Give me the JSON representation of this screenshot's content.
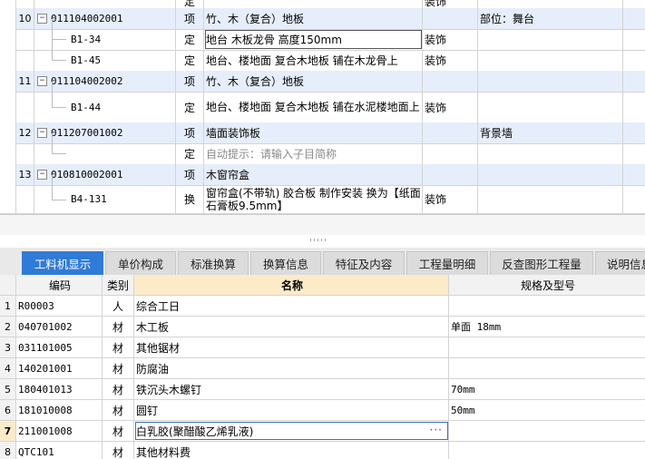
{
  "top_grid": {
    "rows": [
      {
        "idx": "",
        "code": "",
        "type": "定",
        "name": "",
        "major": "装饰",
        "part": "",
        "kind": "child-partial"
      },
      {
        "idx": "10",
        "code": "011104002001",
        "type": "项",
        "name": "竹、木（复合）地板",
        "major": "",
        "part": "部位：舞台",
        "kind": "group"
      },
      {
        "idx": "",
        "code": "B1-34",
        "type": "定",
        "name": "地台 木板龙骨 高度150mm",
        "major": "装饰",
        "part": "",
        "kind": "child"
      },
      {
        "idx": "",
        "code": "B1-45",
        "type": "定",
        "name": "地台、楼地面 复合木地板 铺在木龙骨上",
        "major": "装饰",
        "part": "",
        "kind": "child"
      },
      {
        "idx": "11",
        "code": "011104002002",
        "type": "项",
        "name": "竹、木（复合）地板",
        "major": "",
        "part": "",
        "kind": "group"
      },
      {
        "idx": "",
        "code": "B1-44",
        "type": "定",
        "name": "地台、楼地面 复合木地板 铺在水泥楼地面上",
        "major": "装饰",
        "part": "",
        "kind": "child-tall"
      },
      {
        "idx": "12",
        "code": "011207001002",
        "type": "项",
        "name": "墙面装饰板",
        "major": "",
        "part": "背景墙",
        "kind": "group"
      },
      {
        "idx": "",
        "code": "",
        "type": "定",
        "name": "自动提示：请输入子目简称",
        "major": "",
        "part": "",
        "kind": "child-hint"
      },
      {
        "idx": "13",
        "code": "010810002001",
        "type": "项",
        "name": "木窗帘盒",
        "major": "",
        "part": "",
        "kind": "group"
      },
      {
        "idx": "",
        "code": "B4-131",
        "type": "换",
        "name": "窗帘盒(不带轨) 胶合板 制作安装  换为【纸面石膏板9.5mm】",
        "major": "装饰",
        "part": "",
        "kind": "child-tall"
      }
    ]
  },
  "tabs": [
    "工料机显示",
    "单价构成",
    "标准换算",
    "换算信息",
    "特征及内容",
    "工程量明细",
    "反查图形工程量",
    "说明信息"
  ],
  "bottom_grid": {
    "headers": {
      "code": "编码",
      "type": "类别",
      "name": "名称",
      "spec": "规格及型号"
    },
    "rows": [
      {
        "idx": "1",
        "code": "R00003",
        "type": "人",
        "name": "综合工日",
        "spec": ""
      },
      {
        "idx": "2",
        "code": "040701002",
        "type": "材",
        "name": "木工板",
        "spec": "单面 18mm"
      },
      {
        "idx": "3",
        "code": "031101005",
        "type": "材",
        "name": "其他锯材",
        "spec": ""
      },
      {
        "idx": "4",
        "code": "140201001",
        "type": "材",
        "name": "防腐油",
        "spec": ""
      },
      {
        "idx": "5",
        "code": "180401013",
        "type": "材",
        "name": "铁沉头木螺钉",
        "spec": "70mm"
      },
      {
        "idx": "6",
        "code": "181010008",
        "type": "材",
        "name": "圆钉",
        "spec": "50mm"
      },
      {
        "idx": "7",
        "code": "211001008",
        "type": "材",
        "name": "白乳胶(聚醋酸乙烯乳液)",
        "spec": ""
      },
      {
        "idx": "8",
        "code": "QTC101",
        "type": "材",
        "name": "其他材料费",
        "spec": ""
      }
    ]
  },
  "icons": {
    "expander": "−",
    "ellipsis": "···"
  }
}
